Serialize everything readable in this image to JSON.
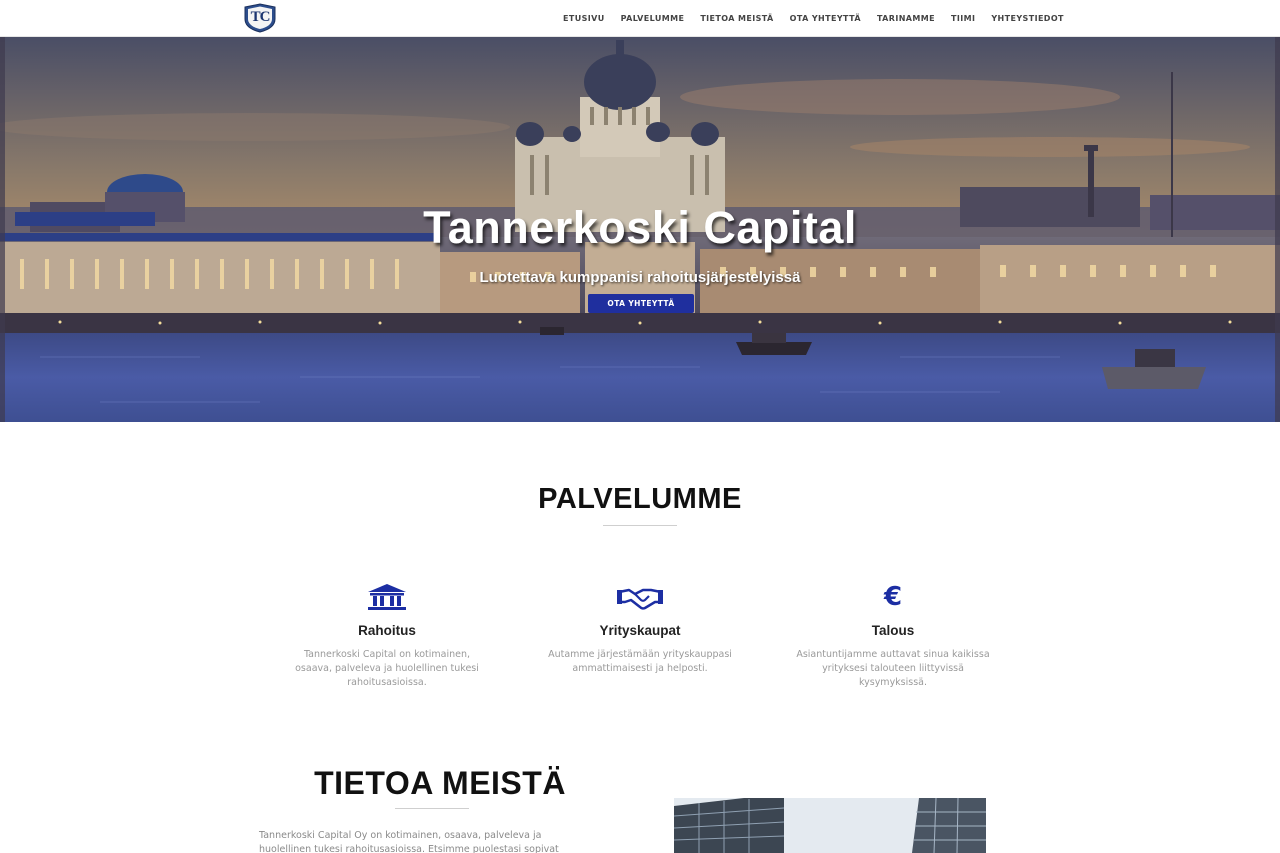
{
  "nav": {
    "logo_text": "TC",
    "items": [
      {
        "label": "ETUSIVU"
      },
      {
        "label": "PALVELUMME"
      },
      {
        "label": "TIETOA MEISTÄ"
      },
      {
        "label": "OTA YHTEYTTÄ"
      },
      {
        "label": "TARINAMME"
      },
      {
        "label": "TIIMI"
      },
      {
        "label": "YHTEYSTIEDOT"
      }
    ]
  },
  "hero": {
    "title": "Tannerkoski Capital",
    "subtitle": "Luotettava kumppanisi rahoitusjärjestelyissä",
    "cta_label": "OTA YHTEYTTÄ"
  },
  "services": {
    "title": "PALVELUMME",
    "items": [
      {
        "icon": "bank-icon",
        "name": "Rahoitus",
        "desc": "Tannerkoski Capital on kotimainen, osaava, palveleva ja huolellinen tukesi rahoitusasioissa."
      },
      {
        "icon": "handshake-icon",
        "name": "Yrityskaupat",
        "desc": "Autamme järjestämään yrityskauppasi ammattimaisesti ja helposti."
      },
      {
        "icon": "euro-icon",
        "name": "Talous",
        "desc": "Asiantuntijamme auttavat sinua kaikissa yrityksesi talouteen liittyvissä kysymyksissä."
      }
    ]
  },
  "about": {
    "title": "TIETOA MEISTÄ",
    "text": "Tannerkoski Capital Oy on kotimainen, osaava, palveleva ja huolellinen tukesi rahoitusasioissa. Etsimme puolestasi sopivat rahoittajat ja"
  },
  "colors": {
    "accent": "#1f2f9e",
    "icon": "#1c2ea3"
  }
}
